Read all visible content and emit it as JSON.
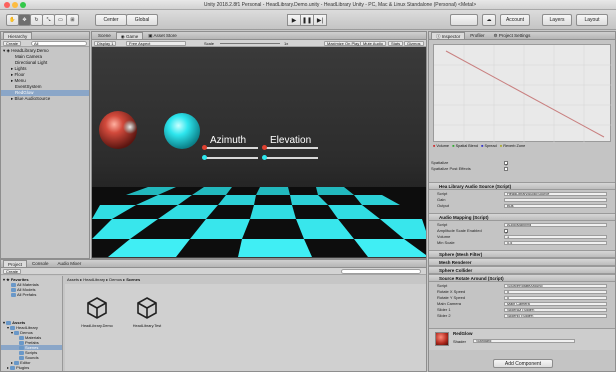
{
  "window": {
    "title": "Unity 2018.2.8f1 Personal - HeadLibrary.Demo.unity - HeadLibrary Unity - PC, Mac & Linux Standalone (Personal) <Metal>"
  },
  "toolbar": {
    "center_label": "Center",
    "global_label": "Global",
    "collab_label": "",
    "account_label": "Account",
    "layers_label": "Layers",
    "layout_label": "Layout"
  },
  "hierarchy": {
    "tab": "Hierarchy",
    "create_label": "Create",
    "search_placeholder": "All",
    "rows": [
      {
        "label": "HeadLibrary.Demo",
        "indent": 1
      },
      {
        "label": "Main Camera",
        "indent": 3
      },
      {
        "label": "Directional Light",
        "indent": 3
      },
      {
        "label": "Lights",
        "indent": 3
      },
      {
        "label": "Floor",
        "indent": 3
      },
      {
        "label": "Menu",
        "indent": 3
      },
      {
        "label": "EventSystem",
        "indent": 3
      },
      {
        "label": "RedGlow",
        "indent": 3
      },
      {
        "label": "Blue AudioSource",
        "indent": 3
      }
    ]
  },
  "view_tabs": {
    "scene": "Scene",
    "game": "Game",
    "asset_store": "Asset Store"
  },
  "game_bar": {
    "display": "Display 1",
    "aspect": "Free Aspect",
    "scale_label": "Scale",
    "scale_value": "1x",
    "maximize": "Maximize On Play",
    "mute": "Mute Audio",
    "stats": "Stats",
    "gizmos": "Gizmos"
  },
  "game_view": {
    "azimuth_label": "Azimuth",
    "elevation_label": "Elevation"
  },
  "project": {
    "tabs": [
      "Project",
      "Console",
      "Audio Mixer"
    ],
    "create_label": "Create",
    "breadcrumb": [
      "Assets",
      "HeadLibrary",
      "Demos",
      "Scenes"
    ],
    "favorites_label": "Favorites",
    "favorites": [
      "All Materials",
      "All Models",
      "All Prefabs"
    ],
    "tree": [
      {
        "label": "Assets",
        "indent": 0
      },
      {
        "label": "HeadLibrary",
        "indent": 1
      },
      {
        "label": "Demos",
        "indent": 2
      },
      {
        "label": "Materials",
        "indent": 3
      },
      {
        "label": "Prefabs",
        "indent": 3
      },
      {
        "label": "Scenes",
        "indent": 3,
        "selected": true
      },
      {
        "label": "Scripts",
        "indent": 3
      },
      {
        "label": "Sounds",
        "indent": 3
      },
      {
        "label": "Editor",
        "indent": 2
      },
      {
        "label": "Plugins",
        "indent": 1
      }
    ],
    "assets": [
      "HeadLibrary.Demo",
      "HeadLibrary.Test"
    ]
  },
  "inspector": {
    "tabs": [
      "Inspector",
      "Profiler",
      "Project Settings"
    ],
    "graph_legend": [
      "Volume",
      "Spatial Blend",
      "Spread",
      "Reverb Zone"
    ],
    "spatialize_label": "Spatialize",
    "spatialize_post_label": "Spatialize Post Effects",
    "components": [
      {
        "title": "Hea Library Audio Source (Script)",
        "props": [
          {
            "label": "Script",
            "value": "HeadLibraryAudioSource"
          },
          {
            "label": "Gain",
            "value": ""
          },
          {
            "label": "Output",
            "value": "Bus"
          }
        ]
      },
      {
        "title": "Audio Mapping (Script)",
        "props": [
          {
            "label": "Script",
            "value": "AudioMapping"
          },
          {
            "label": "Amplitude Scale Enabled",
            "value": "check"
          },
          {
            "label": "Volume",
            "value": "1"
          },
          {
            "label": "Min Scale",
            "value": "0.5"
          }
        ]
      },
      {
        "title": "Sphere (Mesh Filter)",
        "props": []
      },
      {
        "title": "Mesh Renderer",
        "props": []
      },
      {
        "title": "Sphere Collider",
        "props": []
      },
      {
        "title": "Source Rotate Around (Script)",
        "props": [
          {
            "label": "Script",
            "value": "SourceRotateAround"
          },
          {
            "label": "Rotate X Speed",
            "value": "0"
          },
          {
            "label": "Rotate Y Speed",
            "value": "0"
          },
          {
            "label": "Main Camera",
            "value": "Main Camera"
          },
          {
            "label": "Slider 1",
            "value": "SliderAz (Slider)"
          },
          {
            "label": "Slider 2",
            "value": "SliderEl (Slider)"
          }
        ]
      }
    ],
    "material_name": "RedGlow",
    "shader_label": "Shader",
    "shader_value": "Standard",
    "add_component": "Add Component"
  }
}
